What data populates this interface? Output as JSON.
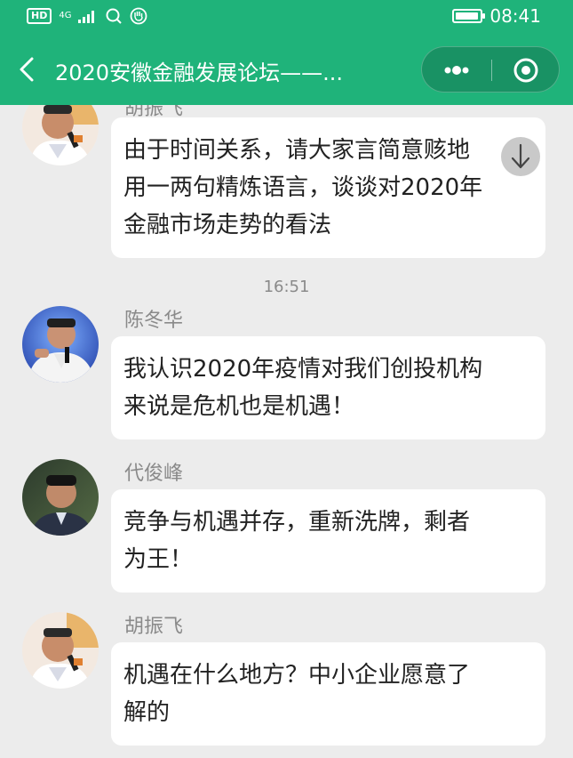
{
  "status_bar": {
    "hd": "HD",
    "network": "4G",
    "time": "08:41",
    "battery_level": 0.95
  },
  "header": {
    "title": "2020安徽金融发展论坛——...",
    "icons": [
      "back-arrow-icon",
      "more-dots-icon",
      "close-target-icon"
    ]
  },
  "chat": {
    "top_bubble": {
      "sender": "胡振飞",
      "lines": [
        "由于时间关系，请大家言简意赅地",
        "用一两句精炼语言，谈谈对2020年",
        "金融市场走势的看法"
      ]
    },
    "timestamp": "16:51",
    "messages": [
      {
        "sender": "陈冬华",
        "lines": [
          "我认识2020年疫情对我们创投机构",
          "来说是危机也是机遇！"
        ]
      },
      {
        "sender": "代俊峰",
        "lines": [
          "竞争与机遇并存，重新洗牌，剩者",
          "为王！"
        ]
      },
      {
        "sender": "胡振飞",
        "lines": [
          "机遇在什么地方？中小企业愿意了",
          "解的"
        ]
      }
    ]
  },
  "colors": {
    "header_bg": "#1fb37a",
    "chat_bg": "#ececec",
    "bubble_bg": "#ffffff"
  }
}
